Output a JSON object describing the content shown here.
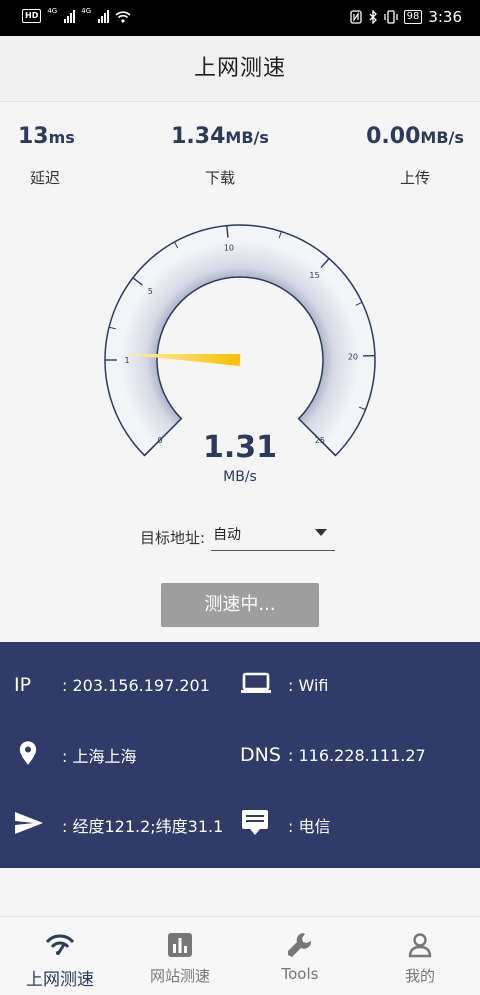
{
  "status_bar": {
    "hd": "HD",
    "sig1": "4G",
    "sig2": "4G",
    "battery": "98",
    "time": "3:36"
  },
  "header": {
    "title": "上网测速"
  },
  "stats": {
    "latency": {
      "value": "13",
      "unit": "ms",
      "label": "延迟"
    },
    "download": {
      "value": "1.34",
      "unit": "MB/s",
      "label": "下载"
    },
    "upload": {
      "value": "0.00",
      "unit": "MB/s",
      "label": "上传"
    }
  },
  "gauge": {
    "ticks": [
      "0",
      "1",
      "5",
      "10",
      "15",
      "20",
      "25"
    ],
    "current_value": "1.31",
    "current_unit": "MB/s",
    "needle_value": 1.31,
    "colors": {
      "dial": "#2d3a5c",
      "needle": "#f5c518"
    }
  },
  "target": {
    "label": "目标地址:",
    "value": "自动"
  },
  "test_button": {
    "label": "测速中..."
  },
  "info": {
    "ip_key": "IP",
    "ip_value": ": 203.156.197.201",
    "net_value": ": Wifi",
    "location_value": ": 上海上海",
    "dns_key": "DNS",
    "dns_value": ": 116.228.111.27",
    "coords_value": ": 经度121.2;纬度31.1",
    "isp_value": ": 电信"
  },
  "nav": {
    "items": [
      {
        "label": "上网测速",
        "icon": "speed-icon"
      },
      {
        "label": "网站测速",
        "icon": "chart-icon"
      },
      {
        "label": "Tools",
        "icon": "wrench-icon"
      },
      {
        "label": "我的",
        "icon": "user-icon"
      }
    ]
  },
  "colors": {
    "accent": "#2d3a5c",
    "panel": "#303b69",
    "button": "#9e9e9e"
  }
}
